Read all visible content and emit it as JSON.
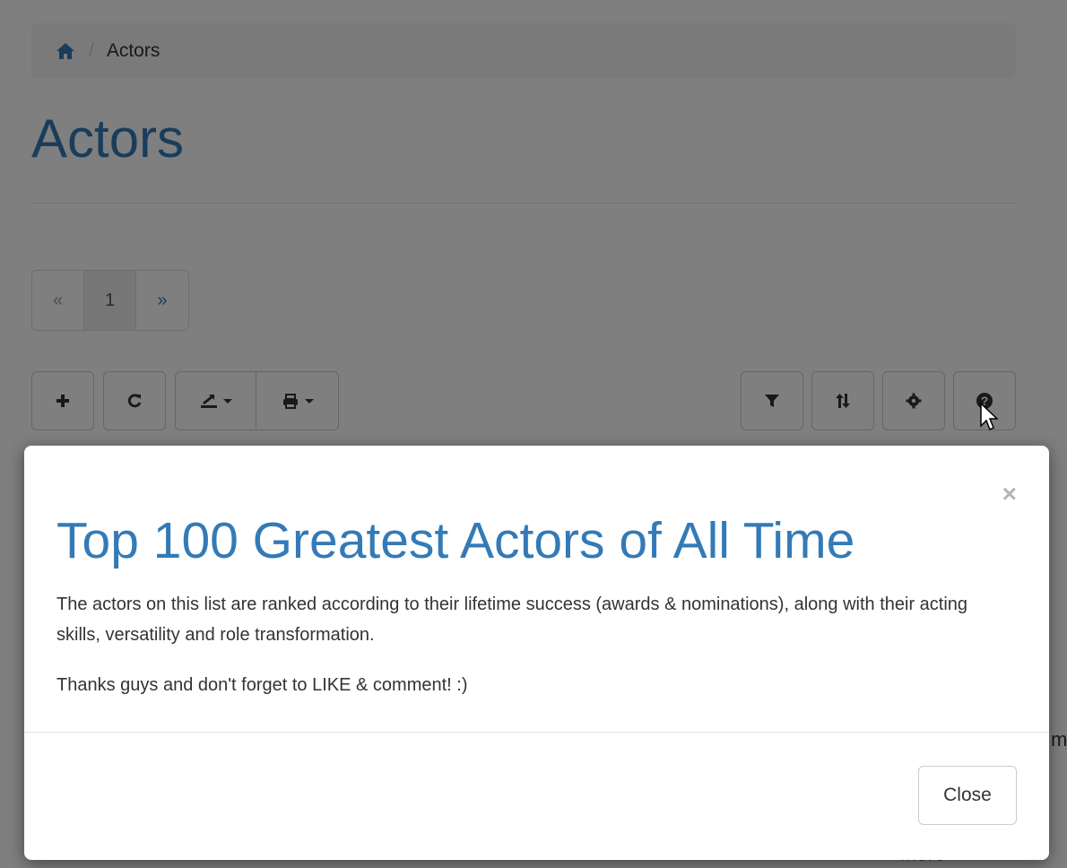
{
  "breadcrumb": {
    "home_icon": "home-icon",
    "separator": "/",
    "current": "Actors"
  },
  "page": {
    "title": "Actors"
  },
  "pagination": {
    "prev": "«",
    "page": "1",
    "next": "»"
  },
  "toolbar": {
    "left": [
      "plus-icon",
      "refresh-icon",
      "export-icon",
      "print-icon"
    ],
    "right": [
      "filter-icon",
      "sort-icon",
      "gear-icon",
      "help-icon"
    ]
  },
  "background_peek": {
    "m": "m",
    "more": "more"
  },
  "modal": {
    "close_x": "×",
    "title": "Top 100 Greatest Actors of All Time",
    "paragraph1": "The actors on this list are ranked according to their lifetime success (awards & nominations), along with their acting skills, versatility and role transformation.",
    "paragraph2": "Thanks guys and don't forget to LIKE & comment! :)",
    "close_button": "Close"
  },
  "colors": {
    "accent": "#337ab7",
    "backdrop": "rgba(0,0,0,0.5)"
  }
}
